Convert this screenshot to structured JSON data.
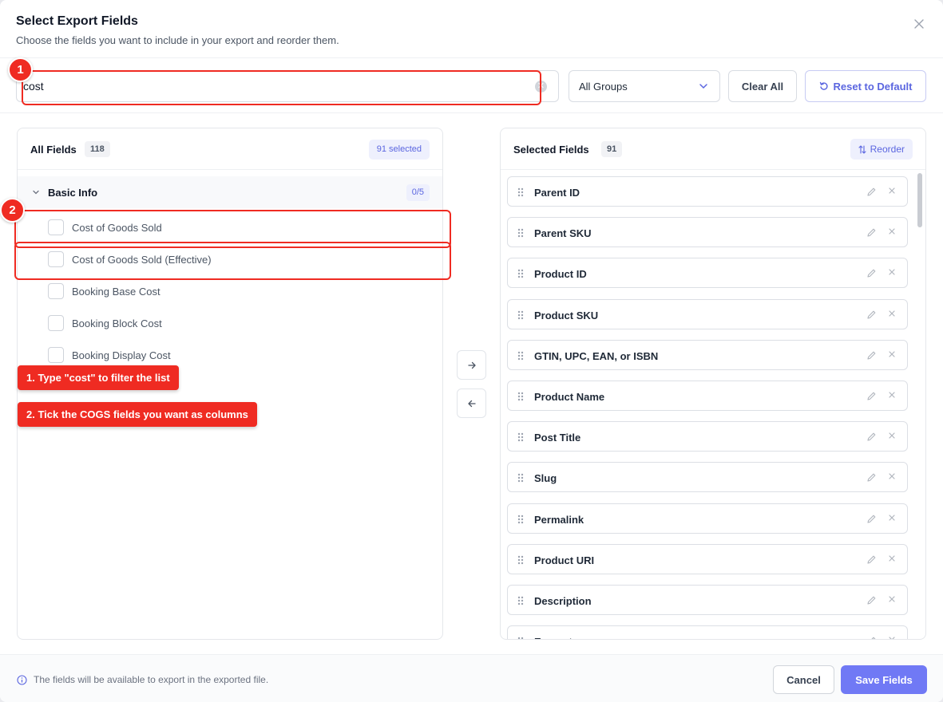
{
  "modal": {
    "title": "Select Export Fields",
    "subtitle": "Choose the fields you want to include in your export and reorder them."
  },
  "toolbar": {
    "search_value": "cost",
    "group_select": "All Groups",
    "clear_all": "Clear All",
    "reset_default": "Reset to Default"
  },
  "all_fields": {
    "title": "All Fields",
    "count": "118",
    "selected_badge": "91 selected",
    "group": {
      "title": "Basic Info",
      "count": "0/5"
    },
    "items": [
      {
        "label": "Cost of Goods Sold"
      },
      {
        "label": "Cost of Goods Sold (Effective)"
      },
      {
        "label": "Booking Base Cost"
      },
      {
        "label": "Booking Block Cost"
      },
      {
        "label": "Booking Display Cost"
      }
    ]
  },
  "selected_fields": {
    "title": "Selected Fields",
    "count": "91",
    "reorder": "Reorder",
    "items": [
      {
        "label": "Parent ID"
      },
      {
        "label": "Parent SKU"
      },
      {
        "label": "Product ID"
      },
      {
        "label": "Product SKU"
      },
      {
        "label": "GTIN, UPC, EAN, or ISBN"
      },
      {
        "label": "Product Name"
      },
      {
        "label": "Post Title"
      },
      {
        "label": "Slug"
      },
      {
        "label": "Permalink"
      },
      {
        "label": "Product URI"
      },
      {
        "label": "Description"
      },
      {
        "label": "Excerpt"
      }
    ]
  },
  "footer": {
    "note": "The fields will be available to export in the exported file.",
    "cancel": "Cancel",
    "save": "Save Fields"
  },
  "annotations": {
    "step1_number": "1",
    "step2_number": "2",
    "callout1": "1. Type \"cost\" to filter the list",
    "callout2": "2. Tick the COGS fields you want as columns"
  },
  "colors": {
    "accent": "#5b66e0",
    "primary_button": "#7079f5",
    "annotation": "#ef2b22"
  }
}
